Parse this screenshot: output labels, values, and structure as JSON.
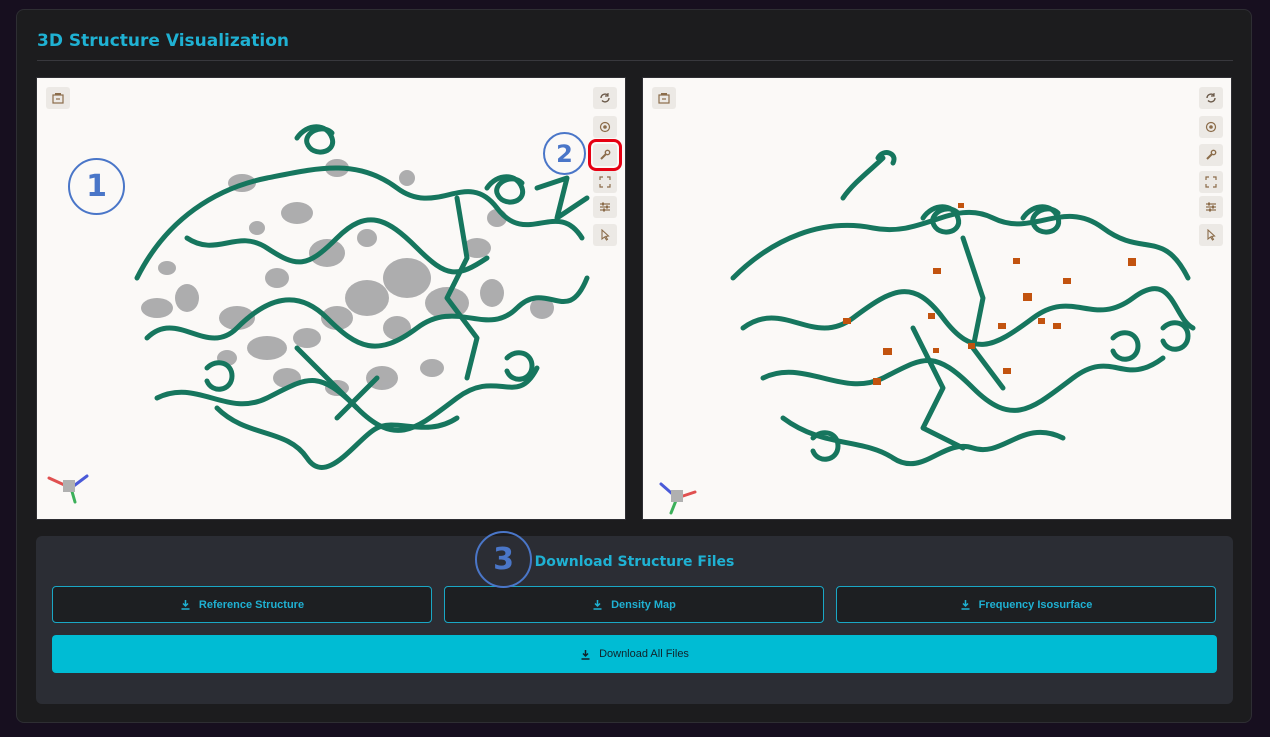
{
  "panel": {
    "title": "3D Structure Visualization"
  },
  "viewers": [
    {
      "id": "reference-density",
      "toolbar": [
        "rotate-icon",
        "center-icon",
        "wrench-icon",
        "fullscreen-icon",
        "settings-sliders-icon",
        "pointer-icon"
      ],
      "snapshot_icon": "camera-save-icon"
    },
    {
      "id": "frequency-isosurface",
      "toolbar": [
        "rotate-icon",
        "center-icon",
        "wrench-icon",
        "fullscreen-icon",
        "settings-sliders-icon",
        "pointer-icon"
      ],
      "snapshot_icon": "camera-save-icon"
    }
  ],
  "annotations": {
    "badge1": "1",
    "badge2": "2",
    "badge3": "3"
  },
  "downloads": {
    "title": "Download Structure Files",
    "reference": "Reference Structure",
    "density": "Density Map",
    "frequency": "Frequency Isosurface",
    "all": "Download All Files"
  },
  "colors": {
    "accent": "#1fb1d3",
    "button_primary": "#00bcd4",
    "protein_ribbon": "#16765e",
    "density_surface": "#a9a9ab",
    "isosurface": "#c2530f",
    "highlight": "#e60012",
    "annotation": "#4a76c8"
  }
}
